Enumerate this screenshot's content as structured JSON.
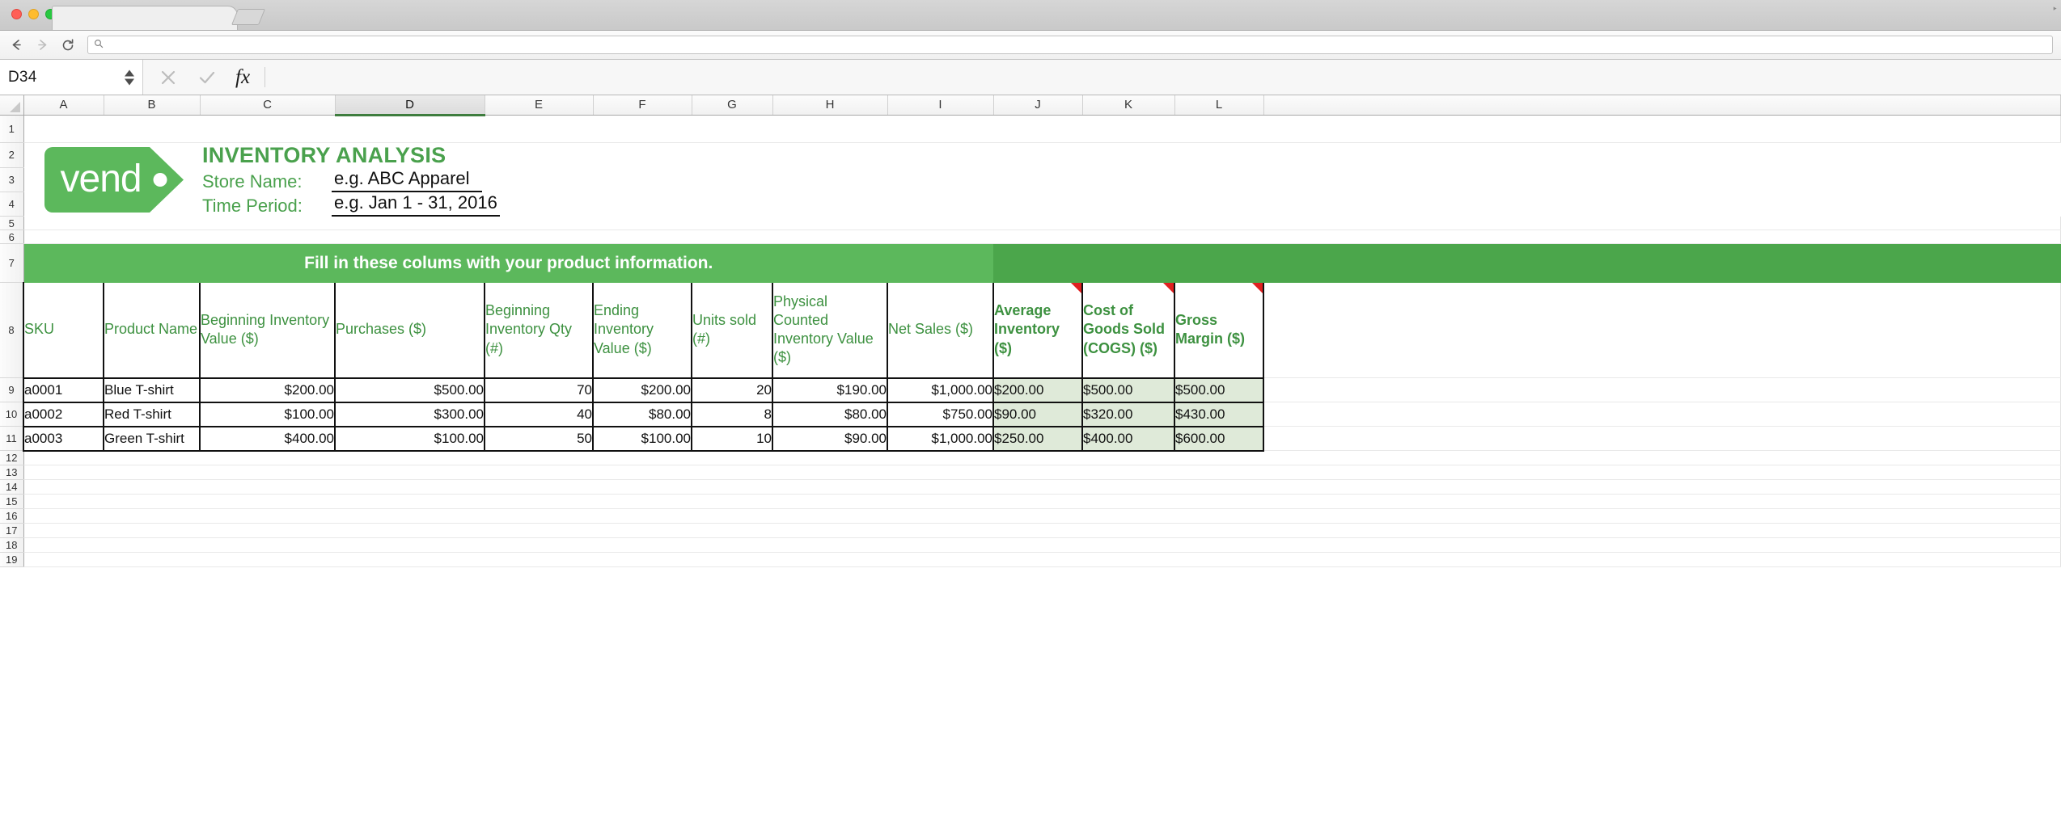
{
  "window": {
    "tab_title": "",
    "traffic_lights": [
      "close",
      "minimize",
      "zoom"
    ]
  },
  "toolbar": {
    "back_label": "back-arrow",
    "forward_label": "forward-arrow",
    "reload_label": "reload",
    "url_value": "",
    "url_placeholder": ""
  },
  "formula_bar": {
    "name_box_value": "D34",
    "cancel_label": "✕",
    "accept_label": "✓",
    "fx_label": "fx",
    "formula_value": "",
    "formula_placeholder": ""
  },
  "grid": {
    "column_headers": [
      "A",
      "B",
      "C",
      "D",
      "E",
      "F",
      "G",
      "H",
      "I",
      "J",
      "K",
      "L"
    ],
    "selected_column": "D",
    "row_headers": [
      "1",
      "2",
      "3",
      "4",
      "5",
      "6",
      "7",
      "8",
      "9",
      "10",
      "11",
      "12",
      "13",
      "14",
      "15",
      "16",
      "17",
      "18",
      "19"
    ]
  },
  "sheet": {
    "title": "INVENTORY ANALYSIS",
    "logo_text": "vend",
    "logo_dot": "•",
    "fields": [
      {
        "label": "Store Name:",
        "value": "e.g. ABC Apparel"
      },
      {
        "label": "Time Period:",
        "value": "e.g. Jan 1 - 31, 2016"
      }
    ],
    "banner_text": "Fill in these colums with your product information.",
    "colors": {
      "brand_green": "#5cb85c",
      "banner_dark_green": "#4ba64b",
      "header_text_green": "#3d9140",
      "calc_cell_bg": "#dfead9",
      "comment_marker_red": "#e02020"
    }
  },
  "table": {
    "headers": [
      {
        "text": "SKU",
        "bold": false,
        "comment": false
      },
      {
        "text": "Product Name",
        "bold": false,
        "comment": false
      },
      {
        "text": "Beginning Inventory Value ($)",
        "bold": false,
        "comment": false
      },
      {
        "text": "Purchases ($)",
        "bold": false,
        "comment": false
      },
      {
        "text": "Beginning Inventory Qty (#)",
        "bold": false,
        "comment": false
      },
      {
        "text": "Ending Inventory Value ($)",
        "bold": false,
        "comment": false
      },
      {
        "text": "Units sold (#)",
        "bold": false,
        "comment": false
      },
      {
        "text": "Physical Counted Inventory Value ($)",
        "bold": false,
        "comment": false
      },
      {
        "text": "Net Sales ($)",
        "bold": false,
        "comment": false
      },
      {
        "text": "Average Inventory ($)",
        "bold": true,
        "comment": true
      },
      {
        "text": "Cost of Goods Sold (COGS) ($)",
        "bold": true,
        "comment": true
      },
      {
        "text": "Gross Margin ($)",
        "bold": true,
        "comment": true
      }
    ],
    "rows": [
      {
        "row_number": "9",
        "sku": "a0001",
        "product_name": "Blue T-shirt",
        "beginning_inventory_value": "$200.00",
        "purchases": "$500.00",
        "beginning_inventory_qty": "70",
        "ending_inventory_value": "$200.00",
        "units_sold": "20",
        "physical_counted_inventory_value": "$190.00",
        "net_sales": "$1,000.00",
        "average_inventory": "$200.00",
        "cogs": "$500.00",
        "gross_margin": "$500.00"
      },
      {
        "row_number": "10",
        "sku": "a0002",
        "product_name": "Red T-shirt",
        "beginning_inventory_value": "$100.00",
        "purchases": "$300.00",
        "beginning_inventory_qty": "40",
        "ending_inventory_value": "$80.00",
        "units_sold": "8",
        "physical_counted_inventory_value": "$80.00",
        "net_sales": "$750.00",
        "average_inventory": "$90.00",
        "cogs": "$320.00",
        "gross_margin": "$430.00"
      },
      {
        "row_number": "11",
        "sku": "a0003",
        "product_name": "Green T-shirt",
        "beginning_inventory_value": "$400.00",
        "purchases": "$100.00",
        "beginning_inventory_qty": "50",
        "ending_inventory_value": "$100.00",
        "units_sold": "10",
        "physical_counted_inventory_value": "$90.00",
        "net_sales": "$1,000.00",
        "average_inventory": "$250.00",
        "cogs": "$400.00",
        "gross_margin": "$600.00"
      }
    ]
  }
}
